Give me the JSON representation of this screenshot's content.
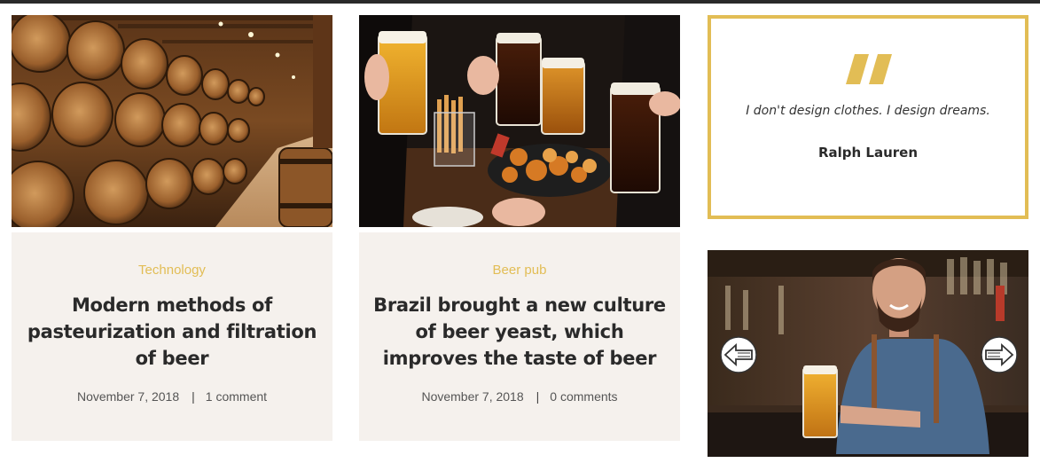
{
  "posts": [
    {
      "category": "Technology",
      "title": "Modern methods of pasteurization and filtration of beer",
      "date": "November 7, 2018",
      "separator": "|",
      "comments": "1 comment",
      "image": "beer-barrels-cellar-photo"
    },
    {
      "category": "Beer pub",
      "title": "Brazil brought a new culture of beer yeast, which improves the taste of beer",
      "date": "November 7, 2018",
      "separator": "|",
      "comments": "0 comments",
      "image": "beer-glasses-and-snacks-photo"
    }
  ],
  "quote": {
    "icon": "quote-icon",
    "text": "I don't design clothes. I design dreams.",
    "author": "Ralph Lauren"
  },
  "slider": {
    "image": "bartender-with-beer-photo",
    "prev_icon": "arrow-left-icon",
    "next_icon": "arrow-right-icon"
  },
  "colors": {
    "accent": "#e2bd55",
    "card_background": "#f5f1ed",
    "heading": "#2a2a2a",
    "top_bar": "#2a2a2a"
  }
}
